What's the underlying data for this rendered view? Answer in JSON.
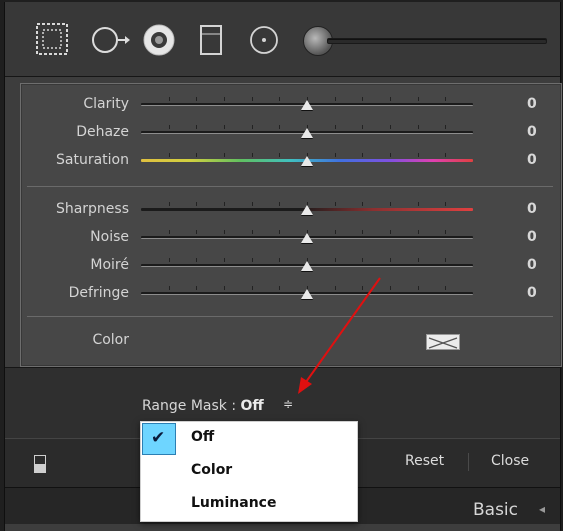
{
  "toolbar": {
    "tools": [
      {
        "name": "graduated-filter-icon"
      },
      {
        "name": "spot-removal-icon"
      },
      {
        "name": "red-eye-icon"
      },
      {
        "name": "crop-icon"
      },
      {
        "name": "radial-filter-icon"
      },
      {
        "name": "adjustment-brush-icon"
      }
    ],
    "slider_value": 0.0
  },
  "sliders": [
    {
      "label": "Clarity",
      "value": "0",
      "track": "plain"
    },
    {
      "label": "Dehaze",
      "value": "0",
      "track": "plain"
    },
    {
      "label": "Saturation",
      "value": "0",
      "track": "rainbow"
    },
    {
      "label": "Sharpness",
      "value": "0",
      "track": "redend"
    },
    {
      "label": "Noise",
      "value": "0",
      "track": "plain"
    },
    {
      "label": "Moiré",
      "value": "0",
      "track": "plain"
    },
    {
      "label": "Defringe",
      "value": "0",
      "track": "plain"
    }
  ],
  "color": {
    "label": "Color"
  },
  "range_mask": {
    "label": "Range Mask :",
    "value": "Off",
    "arrows": "≑"
  },
  "menu": {
    "items": [
      {
        "label": "Off",
        "checked": true
      },
      {
        "label": "Color",
        "checked": false
      },
      {
        "label": "Luminance",
        "checked": false
      }
    ]
  },
  "footer": {
    "reset": "Reset",
    "close": "Close"
  },
  "panel_header": {
    "title": "Basic",
    "collapse_icon": "◂"
  },
  "colors": {
    "accent_arrow": "#e01010",
    "check_highlight": "#6ed5ff"
  }
}
